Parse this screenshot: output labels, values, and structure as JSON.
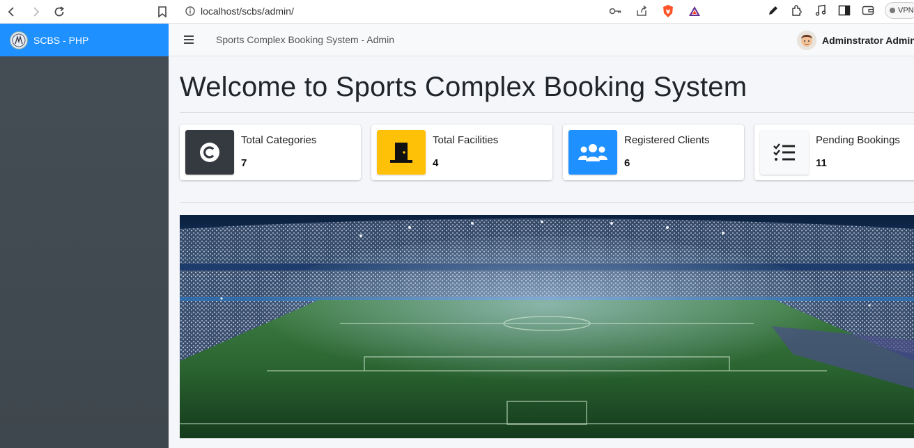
{
  "browser": {
    "url": "localhost/scbs/admin/",
    "vpn_label": "VPN"
  },
  "sidebar": {
    "brand_text": "SCBS - PHP"
  },
  "navbar": {
    "system_title": "Sports Complex Booking System - Admin",
    "user_name": "Adminstrator Admin"
  },
  "main": {
    "page_title": "Welcome to Sports Complex Booking System",
    "cards": [
      {
        "label": "Total Categories",
        "value": "7",
        "icon": "copyright-icon",
        "color": "#343a40"
      },
      {
        "label": "Total Facilities",
        "value": "4",
        "icon": "door-icon",
        "color": "#ffc107"
      },
      {
        "label": "Registered Clients",
        "value": "6",
        "icon": "users-icon",
        "color": "#1e90ff"
      },
      {
        "label": "Pending Bookings",
        "value": "11",
        "icon": "tasks-icon",
        "color": "#f8f9fa"
      }
    ]
  },
  "colors": {
    "brand_blue": "#1e90ff",
    "sidebar_dark": "#454d55"
  }
}
